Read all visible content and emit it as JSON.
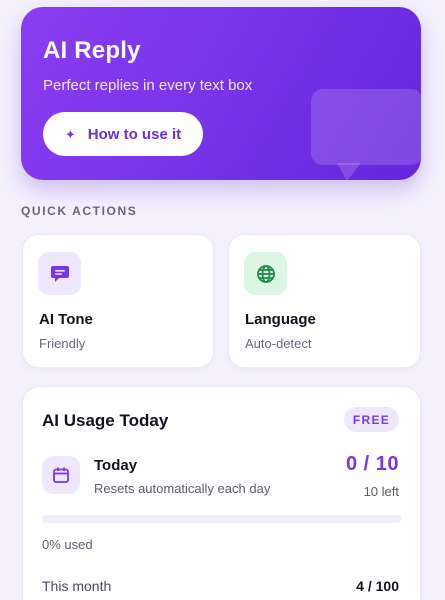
{
  "hero": {
    "title": "AI Reply",
    "subtitle": "Perfect replies in every text box",
    "button_label": "How to use it",
    "button_icon": "sparkle-icon",
    "accent_color": "#7a35ea"
  },
  "quick_actions": {
    "section_label": "QUICK ACTIONS",
    "items": [
      {
        "title": "AI Tone",
        "value": "Friendly",
        "icon": "chat-bubble-icon",
        "icon_color": "#7a35e6"
      },
      {
        "title": "Language",
        "value": "Auto-detect",
        "icon": "globe-icon",
        "icon_color": "#1f8a48"
      }
    ]
  },
  "usage": {
    "title": "AI Usage Today",
    "plan_badge": "FREE",
    "period_label": "Today",
    "period_sub": "Resets automatically each day",
    "count_display": "0 / 10",
    "remaining_text": "10 left",
    "progress_fraction": 0,
    "percent_used_text": "0% used",
    "month_label": "This month",
    "month_value": "4 / 100"
  }
}
